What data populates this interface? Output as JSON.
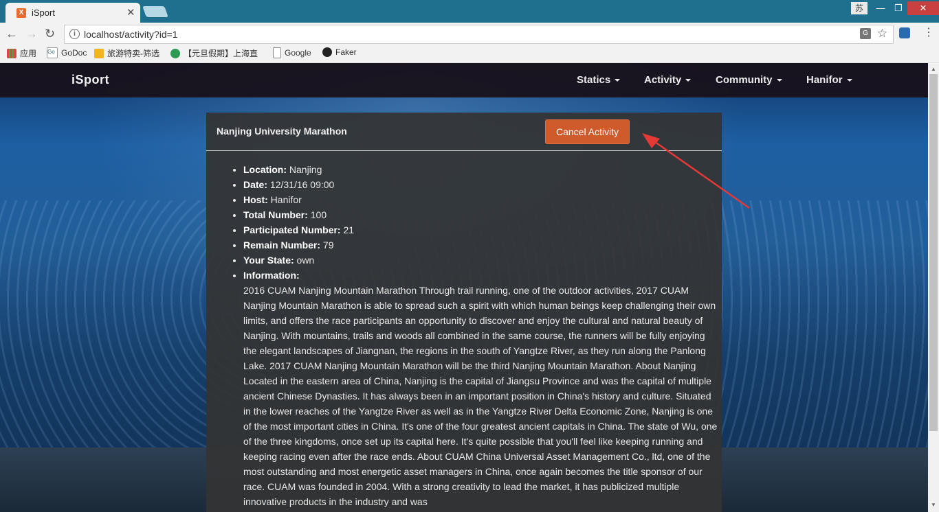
{
  "browser": {
    "tab_title": "iSport",
    "favicon": "X",
    "ime_label": "苏",
    "url": "localhost/activity?id=1",
    "bookmarks": [
      {
        "label": "应用",
        "icon": "apps-grid-icon"
      },
      {
        "label": "GoDoc",
        "icon": "godoc-icon"
      },
      {
        "label": "旅游特卖-筛选",
        "icon": "travel-icon"
      },
      {
        "label": "【元旦假期】上海直",
        "icon": "holiday-icon"
      },
      {
        "label": "Google",
        "icon": "page-icon"
      },
      {
        "label": "Faker",
        "icon": "github-icon"
      }
    ]
  },
  "navbar": {
    "brand": "iSport",
    "menus": [
      "Statics",
      "Activity",
      "Community",
      "Hanifor"
    ]
  },
  "activity": {
    "title": "Nanjing University Marathon",
    "cancel_label": "Cancel Activity",
    "fields": [
      {
        "label": "Location:",
        "value": "Nanjing"
      },
      {
        "label": "Date:",
        "value": "12/31/16 09:00"
      },
      {
        "label": "Host:",
        "value": "Hanifor"
      },
      {
        "label": "Total Number:",
        "value": "100"
      },
      {
        "label": "Participated Number:",
        "value": "21"
      },
      {
        "label": "Remain Number:",
        "value": "79"
      },
      {
        "label": "Your State:",
        "value": "own"
      }
    ],
    "information_label": "Information:",
    "information": "2016 CUAM Nanjing Mountain Marathon Through trail running, one of the outdoor activities, 2017 CUAM Nanjing Mountain Marathon is able to spread such a spirit with which human beings keep challenging their own limits, and offers the race participants an opportunity to discover and enjoy the cultural and natural beauty of Nanjing. With mountains, trails and woods all combined in the same course, the runners will be fully enjoying the elegant landscapes of Jiangnan, the regions in the south of Yangtze River, as they run along the Panlong Lake. 2017 CUAM Nanjing Mountain Marathon will be the third Nanjing Mountain Marathon. About Nanjing Located in the eastern area of China, Nanjing is the capital of Jiangsu Province and was the capital of multiple ancient Chinese Dynasties. It has always been in an important position in China's history and culture. Situated in the lower reaches of the Yangtze River as well as in the Yangtze River Delta Economic Zone, Nanjing is one of the most important cities in China. It's one of the four greatest ancient capitals in China. The state of Wu, one of the three kingdoms, once set up its capital here. It's quite possible that you'll feel like keeping running and keeping racing even after the race ends. About CUAM China Universal Asset Management Co., ltd, one of the most outstanding and most energetic asset managers in China, once again becomes the title sponsor of our race. CUAM was founded in 2004. With a strong creativity to lead the market, it has publicized multiple innovative products in the industry and was"
  },
  "colors": {
    "cancel_button": "#cf5a2c",
    "navbar": "#18121c",
    "panel": "#343434",
    "annotation_arrow": "#e53935"
  }
}
